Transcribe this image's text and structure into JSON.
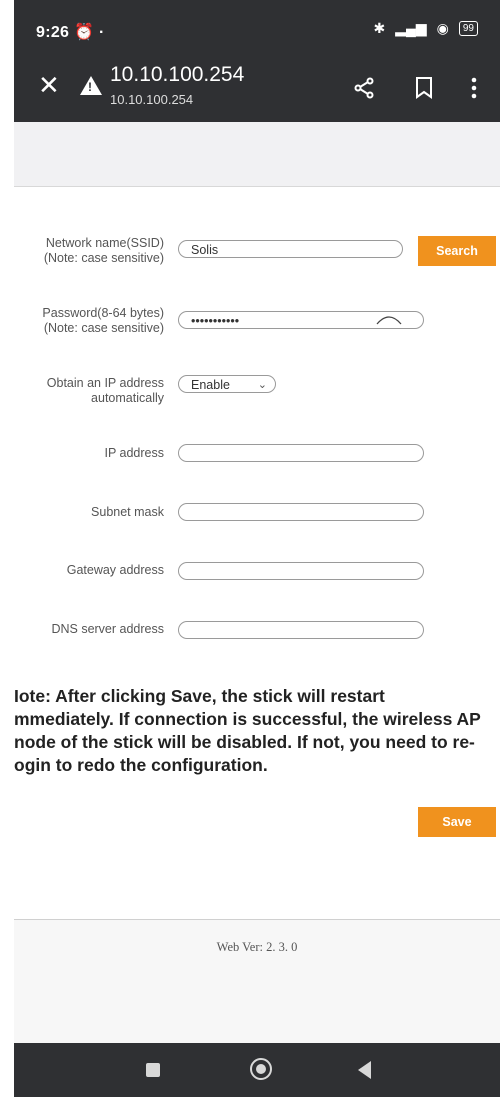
{
  "status_bar": {
    "time": "9:26",
    "battery": "99"
  },
  "browser": {
    "url_title": "10.10.100.254",
    "url_sub": "10.10.100.254"
  },
  "form": {
    "ssid_label_1": "Network name(SSID)",
    "ssid_label_2": "(Note: case sensitive)",
    "ssid_value": "Solis",
    "search_label": "Search",
    "password_label_1": "Password(8-64 bytes)",
    "password_label_2": "(Note: case sensitive)",
    "password_value": "•••••••••••",
    "dhcp_label_1": "Obtain an IP address",
    "dhcp_label_2": "automatically",
    "dhcp_value": "Enable",
    "ip_label": "IP address",
    "subnet_label": "Subnet mask",
    "gateway_label": "Gateway address",
    "dns_label": "DNS server address"
  },
  "note": {
    "line1": "Іote: After clicking Save, the stick will restart",
    "line2": "mmediately. If connection is successful, the wireless AP",
    "line3": "node of the stick will be disabled. If not, you need to re-",
    "line4": "ogin to redo the configuration."
  },
  "save_label": "Save",
  "footer": {
    "version": "Web Ver: 2. 3. 0"
  }
}
